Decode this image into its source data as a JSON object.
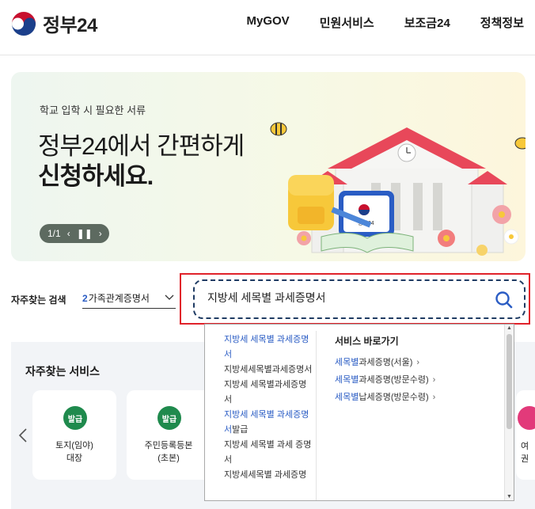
{
  "header": {
    "logo_text": "정부24",
    "nav": [
      "MyGOV",
      "민원서비스",
      "보조금24",
      "정책정보"
    ]
  },
  "banner": {
    "subtitle": "학교 입학 시 필요한 서류",
    "title_line1": "정부24에서 간편하게",
    "title_line2": "신청하세요.",
    "pager": "1/1",
    "tablet_label": "정부24"
  },
  "search": {
    "faq_label": "자주찾는 검색",
    "faq_selected_number": "2",
    "faq_selected_text": "가족관계증명서",
    "query": "지방세 세목별 과세증명서"
  },
  "autocomplete": {
    "suggestions": [
      {
        "kw": "지방세 세목별 과세증명서",
        "rest": "",
        "highlight": true
      },
      {
        "kw": "",
        "rest": "지방세세목별과세증명서",
        "highlight": false
      },
      {
        "kw": "",
        "rest": "지방세 세목별과세증명서",
        "highlight": false
      },
      {
        "kw": "지방세 세목별 과세증명서",
        "rest": "발급",
        "highlight": false
      },
      {
        "kw": "",
        "rest": "지방세 세목별 과세 증명서",
        "highlight": false
      },
      {
        "kw": "",
        "rest": "지방세세목별 과세증명",
        "highlight": false
      }
    ],
    "shortcut_title": "서비스 바로가기",
    "shortcuts": [
      {
        "kw": "세목별",
        "rest": "과세증명(서울)"
      },
      {
        "kw": "세목별",
        "rest": "과세증명(방문수령)"
      },
      {
        "kw": "세목별",
        "rest": "납세증명(방문수령)"
      }
    ]
  },
  "services": {
    "title": "자주찾는 서비스",
    "cards": [
      {
        "badge": "발급",
        "label": "토지(임야)\n대장"
      },
      {
        "badge": "발급",
        "label": "주민등록등본\n(초본)"
      }
    ],
    "edge_card_label": "여권"
  },
  "colors": {
    "accent_blue": "#2a5cc4",
    "highlight_red": "#e0222a",
    "badge_green": "#1f8a4d",
    "search_border": "#1f3b63"
  }
}
